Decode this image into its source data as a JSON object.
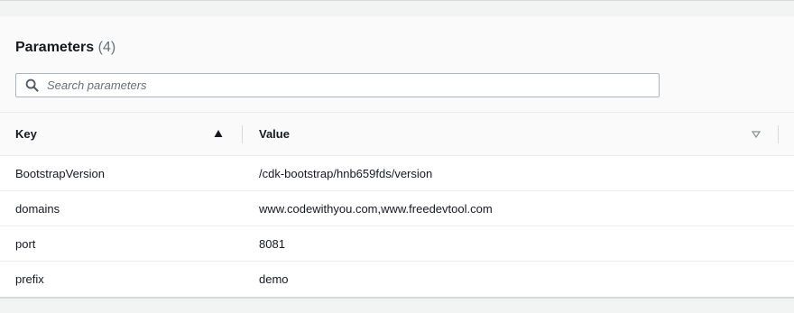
{
  "panel": {
    "title": "Parameters",
    "count": "(4)",
    "search": {
      "placeholder": "Search parameters",
      "value": ""
    }
  },
  "table": {
    "columns": [
      {
        "label": "Key",
        "sort": "ascending"
      },
      {
        "label": "Value",
        "sort": "none"
      }
    ],
    "rows": [
      {
        "key": "BootstrapVersion",
        "value": "/cdk-bootstrap/hnb659fds/version"
      },
      {
        "key": "domains",
        "value": "www.codewithyou.com,www.freedevtool.com"
      },
      {
        "key": "port",
        "value": "8081"
      },
      {
        "key": "prefix",
        "value": "demo"
      }
    ]
  },
  "icons": {
    "search": "search-icon",
    "sort_asc": "sort-ascending-icon",
    "sort_desc": "sort-descending-icon"
  }
}
